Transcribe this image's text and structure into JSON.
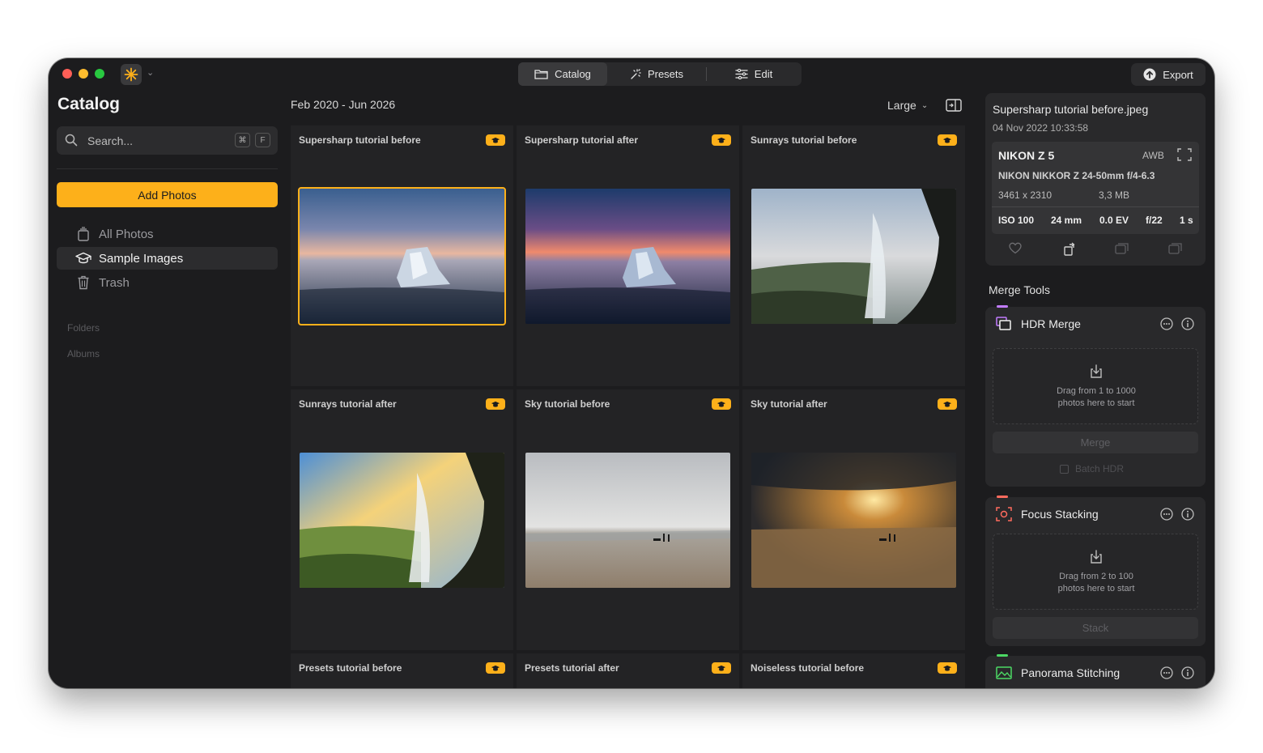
{
  "colors": {
    "accent": "#fdb01a",
    "window_bg": "#1c1c1e",
    "panel_bg": "#29292b",
    "hdr_accent": "#c27cff",
    "focus_accent": "#ff6b5e",
    "panorama_accent": "#4cd964"
  },
  "titlebar": {
    "app_icon": "sun-asterisk-icon",
    "tabs": [
      {
        "label": "Catalog",
        "icon": "folder-icon",
        "active": true
      },
      {
        "label": "Presets",
        "icon": "sparkles-icon",
        "active": false
      },
      {
        "label": "Edit",
        "icon": "sliders-icon",
        "active": false
      }
    ],
    "export_label": "Export"
  },
  "sidebar": {
    "title": "Catalog",
    "search_placeholder": "Search...",
    "shortcut_keys": [
      "⌘",
      "F"
    ],
    "add_photos_label": "Add Photos",
    "items": [
      {
        "label": "All Photos",
        "icon": "stack-icon",
        "selected": false
      },
      {
        "label": "Sample Images",
        "icon": "graduation-cap-icon",
        "selected": true
      },
      {
        "label": "Trash",
        "icon": "trash-icon",
        "selected": false
      }
    ],
    "sections": [
      "Folders",
      "Albums"
    ]
  },
  "main": {
    "date_range": "Feb 2020 - Jun 2026",
    "thumbnail_size": "Large",
    "photos": [
      {
        "title": "Supersharp tutorial before",
        "selected": true
      },
      {
        "title": "Supersharp tutorial after",
        "selected": false
      },
      {
        "title": "Sunrays tutorial before",
        "selected": false
      },
      {
        "title": "Sunrays tutorial after",
        "selected": false
      },
      {
        "title": "Sky tutorial before",
        "selected": false
      },
      {
        "title": "Sky tutorial after",
        "selected": false
      },
      {
        "title": "Presets tutorial before",
        "selected": false
      },
      {
        "title": "Presets tutorial after",
        "selected": false
      },
      {
        "title": "Noiseless tutorial before",
        "selected": false
      }
    ]
  },
  "info": {
    "filename": "Supersharp tutorial before.jpeg",
    "datetime": "04 Nov 2022 10:33:58",
    "camera": "NIKON Z 5",
    "white_balance": "AWB",
    "lens": "NIKON NIKKOR Z 24-50mm f/4-6.3",
    "resolution": "3461 x 2310",
    "file_size": "3,3 MB",
    "iso": "ISO 100",
    "focal_length": "24 mm",
    "exposure_comp": "0.0 EV",
    "aperture": "f/22",
    "shutter": "1 s"
  },
  "merge_tools": {
    "header": "Merge Tools",
    "hdr": {
      "name": "HDR Merge",
      "drop_line1": "Drag from 1 to 1000",
      "drop_line2": "photos here to start",
      "button": "Merge",
      "batch_label": "Batch HDR"
    },
    "focus": {
      "name": "Focus Stacking",
      "drop_line1": "Drag from 2 to 100",
      "drop_line2": "photos here to start",
      "button": "Stack"
    },
    "panorama": {
      "name": "Panorama Stitching"
    }
  }
}
